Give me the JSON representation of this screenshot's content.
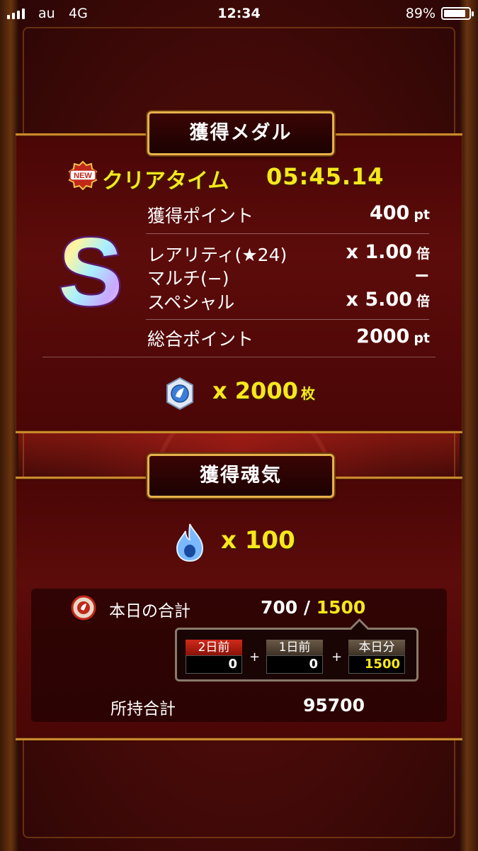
{
  "status_bar": {
    "carrier": "au",
    "network": "4G",
    "time": "12:34",
    "battery_percent": "89%",
    "battery_level": 0.89
  },
  "medal_section": {
    "title": "獲得メダル",
    "new_badge": "NEW",
    "clear_time_label": "クリアタイム",
    "clear_time": "05:45.14",
    "rank": "S",
    "rows": {
      "points_label": "獲得ポイント",
      "points_value": "400",
      "points_unit": "pt",
      "rarity_label": "レアリティ(★24)",
      "rarity_value": "x 1.00",
      "rarity_unit": "倍",
      "multi_label": "マルチ(−)",
      "multi_value": "−",
      "special_label": "スペシャル",
      "special_value": "x 5.00",
      "special_unit": "倍",
      "total_label": "総合ポイント",
      "total_value": "2000",
      "total_unit": "pt"
    },
    "medal_count": "x 2000",
    "medal_unit": "枚"
  },
  "soul_section": {
    "title": "獲得魂気",
    "soul_count": "x 100",
    "today_label": "本日の合計",
    "today_current": "700 /",
    "today_max": "1500",
    "breakdown": [
      {
        "label": "2日前",
        "value": "0"
      },
      {
        "label": "1日前",
        "value": "0"
      },
      {
        "label": "本日分",
        "value": "1500"
      }
    ],
    "plus": "+",
    "owned_label": "所持合計",
    "owned_value": "95700"
  },
  "colors": {
    "accent_yellow": "#f8e71c",
    "gold_border": "#c98a2c",
    "panel_red": "#5c0c0a"
  }
}
